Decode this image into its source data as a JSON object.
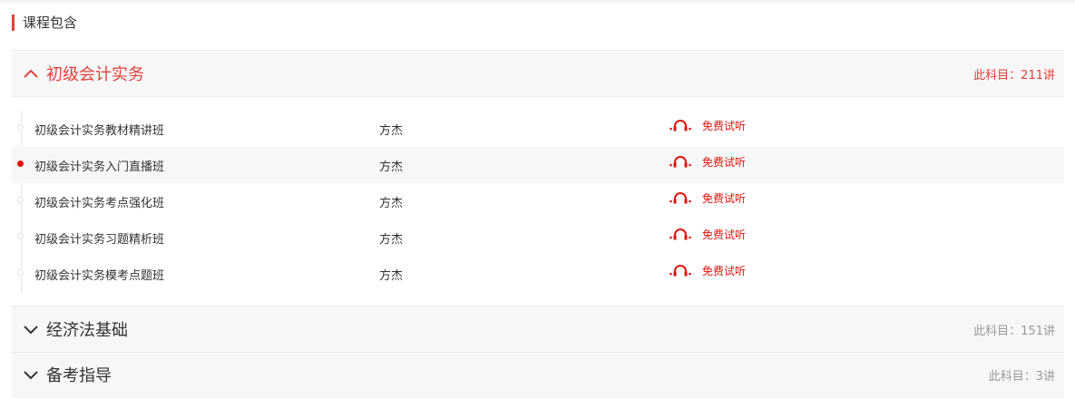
{
  "header": {
    "title": "课程包含"
  },
  "theme": {
    "accent": "#e0413a",
    "listen_color": "#e0130d",
    "muted": "#999999"
  },
  "subjects": [
    {
      "name": "初级会计实务",
      "count": "此科目：211讲",
      "expanded": true
    },
    {
      "name": "经济法基础",
      "count": "此科目：151讲",
      "expanded": false
    },
    {
      "name": "备考指导",
      "count": "此科目：3讲",
      "expanded": false
    }
  ],
  "courses": [
    {
      "name": "初级会计实务教材精讲班",
      "teacher": "方杰",
      "action": "免费试听",
      "icon": "headphones-icon"
    },
    {
      "name": "初级会计实务入门直播班",
      "teacher": "方杰",
      "action": "免费试听",
      "icon": "headphones-icon"
    },
    {
      "name": "初级会计实务考点强化班",
      "teacher": "方杰",
      "action": "免费试听",
      "icon": "headphones-icon"
    },
    {
      "name": "初级会计实务习题精析班",
      "teacher": "方杰",
      "action": "免费试听",
      "icon": "headphones-icon"
    },
    {
      "name": "初级会计实务模考点题班",
      "teacher": "方杰",
      "action": "免费试听",
      "icon": "headphones-icon"
    }
  ]
}
